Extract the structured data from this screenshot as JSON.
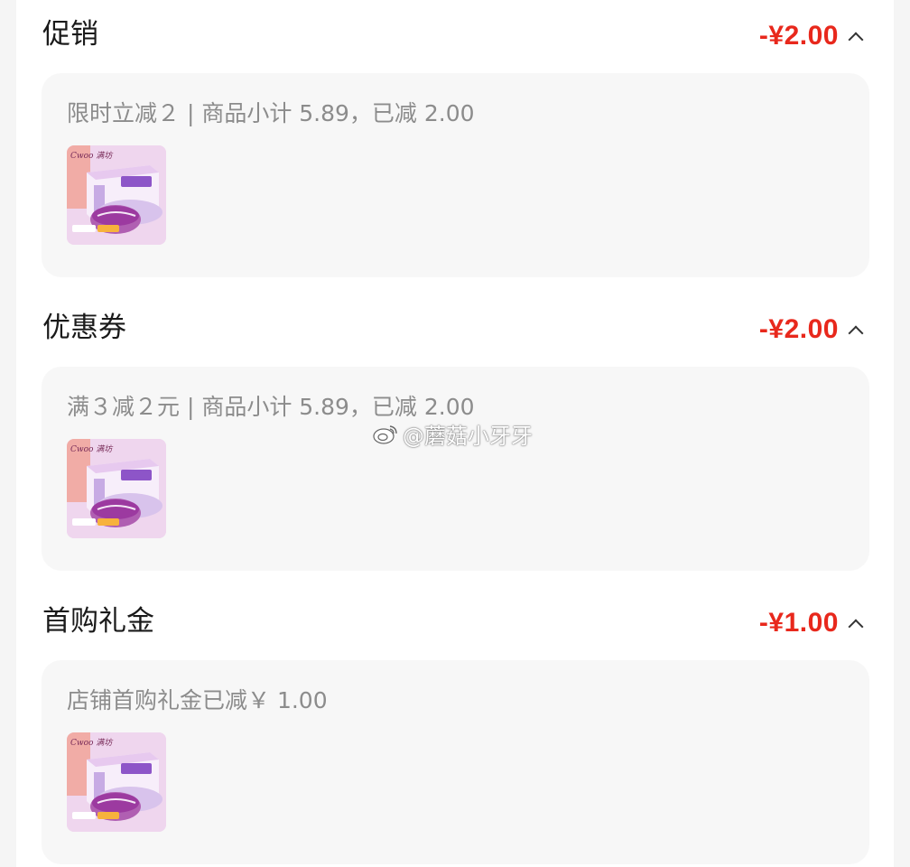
{
  "sections": [
    {
      "title": "促销",
      "amount": "-¥2.00",
      "description": "限时立减２ | 商品小计 5.89，已减 2.00",
      "product_image": "purple-pastry-box-thumbnail"
    },
    {
      "title": "优惠券",
      "amount": "-¥2.00",
      "description": "满３减２元 | 商品小计 5.89，已减 2.00",
      "product_image": "purple-pastry-box-thumbnail"
    },
    {
      "title": "首购礼金",
      "amount": "-¥1.00",
      "description": "店铺首购礼金已减￥ 1.00",
      "product_image": "purple-pastry-box-thumbnail"
    }
  ],
  "watermark": "@蘑菇小牙牙",
  "colors": {
    "amount": "#e8281c",
    "card_bg": "#f7f7f7",
    "page_bg": "#ffffff",
    "desc_text": "#8c8c8c"
  }
}
